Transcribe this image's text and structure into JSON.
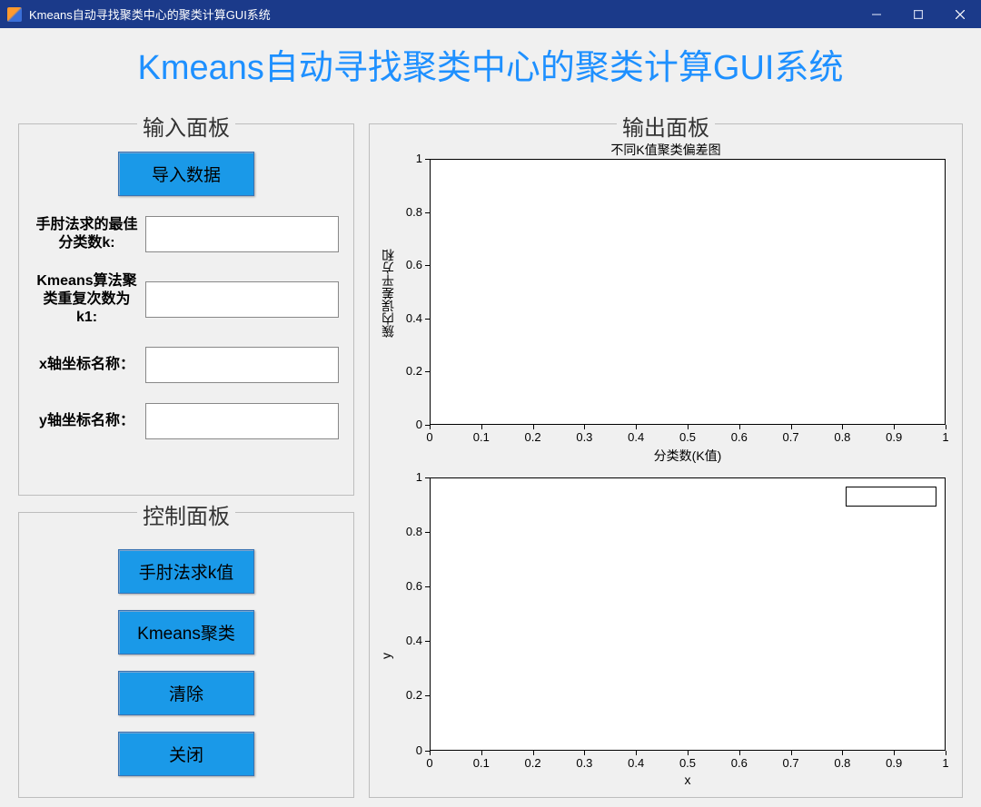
{
  "window": {
    "title": "Kmeans自动寻找聚类中心的聚类计算GUI系统"
  },
  "main_title": "Kmeans自动寻找聚类中心的聚类计算GUI系统",
  "panels": {
    "input": {
      "legend": "输入面板",
      "import_button": "导入数据",
      "fields": {
        "best_k": {
          "label": "手肘法求的最佳分类数k:",
          "value": ""
        },
        "repeat_k1": {
          "label": "Kmeans算法聚类重复次数为k1:",
          "value": ""
        },
        "x_name": {
          "label": "x轴坐标名称：",
          "value": ""
        },
        "y_name": {
          "label": "y轴坐标名称：",
          "value": ""
        }
      }
    },
    "control": {
      "legend": "控制面板",
      "buttons": {
        "elbow": "手肘法求k值",
        "kmeans": "Kmeans聚类",
        "clear": "清除",
        "close": "关闭"
      }
    },
    "output": {
      "legend": "输出面板"
    }
  },
  "chart_data": [
    {
      "type": "line",
      "title": "不同K值聚类偏差图",
      "xlabel": "分类数(K值)",
      "ylabel": "簇内误差平方和",
      "xlim": [
        0,
        1
      ],
      "ylim": [
        0,
        1
      ],
      "x_ticks": [
        0,
        0.1,
        0.2,
        0.3,
        0.4,
        0.5,
        0.6,
        0.7,
        0.8,
        0.9,
        1
      ],
      "y_ticks": [
        0,
        0.2,
        0.4,
        0.6,
        0.8,
        1
      ],
      "series": []
    },
    {
      "type": "scatter",
      "title": "",
      "xlabel": "x",
      "ylabel": "y",
      "xlim": [
        0,
        1
      ],
      "ylim": [
        0,
        1
      ],
      "x_ticks": [
        0,
        0.1,
        0.2,
        0.3,
        0.4,
        0.5,
        0.6,
        0.7,
        0.8,
        0.9,
        1
      ],
      "y_ticks": [
        0,
        0.2,
        0.4,
        0.6,
        0.8,
        1
      ],
      "legend": {
        "visible": true,
        "entries": []
      },
      "series": []
    }
  ]
}
